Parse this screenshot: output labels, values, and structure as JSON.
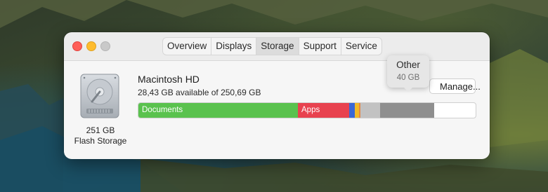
{
  "window": {
    "tabs": [
      {
        "label": "Overview",
        "selected": false
      },
      {
        "label": "Displays",
        "selected": false
      },
      {
        "label": "Storage",
        "selected": true
      },
      {
        "label": "Support",
        "selected": false
      },
      {
        "label": "Service",
        "selected": false
      }
    ]
  },
  "drive": {
    "icon": "hard-drive-icon",
    "capacity": "251 GB",
    "type": "Flash Storage"
  },
  "volume": {
    "name": "Macintosh HD",
    "available": "28,43 GB available of 250,69 GB",
    "manage_label": "Manage..."
  },
  "storage_bar": {
    "segments": [
      {
        "key": "documents",
        "label": "Documents",
        "color": "#5ac24e",
        "fraction": 0.475
      },
      {
        "key": "apps",
        "label": "Apps",
        "color": "#e8424f",
        "fraction": 0.152
      },
      {
        "key": "blue",
        "label": "",
        "color": "#3a67d6",
        "fraction": 0.017
      },
      {
        "key": "yellow",
        "label": "",
        "color": "#f2b928",
        "fraction": 0.013
      },
      {
        "key": "orange",
        "label": "",
        "color": "#e5884a",
        "fraction": 0.004
      },
      {
        "key": "system",
        "label": "",
        "color": "#c2c2c2",
        "fraction": 0.058
      },
      {
        "key": "other",
        "label": "",
        "color": "#8f8f8f",
        "fraction": 0.161
      }
    ],
    "tooltip": {
      "title": "Other",
      "value": "40 GB"
    }
  }
}
